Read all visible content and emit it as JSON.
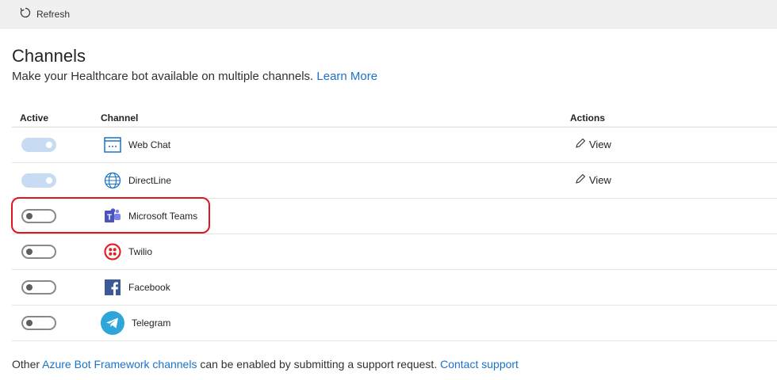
{
  "toolbar": {
    "refresh_label": "Refresh"
  },
  "page": {
    "title": "Channels",
    "subtitle": "Make your Healthcare bot available on multiple channels.",
    "learn_more": "Learn More"
  },
  "table": {
    "headers": {
      "active": "Active",
      "channel": "Channel",
      "actions": "Actions"
    },
    "rows": [
      {
        "name": "Web Chat",
        "active": true,
        "action": "View",
        "icon": "web-chat-icon"
      },
      {
        "name": "DirectLine",
        "active": true,
        "action": "View",
        "icon": "globe-icon"
      },
      {
        "name": "Microsoft Teams",
        "active": false,
        "action": "",
        "icon": "teams-icon"
      },
      {
        "name": "Twilio",
        "active": false,
        "action": "",
        "icon": "twilio-icon"
      },
      {
        "name": "Facebook",
        "active": false,
        "action": "",
        "icon": "facebook-icon"
      },
      {
        "name": "Telegram",
        "active": false,
        "action": "",
        "icon": "telegram-icon"
      }
    ]
  },
  "footer": {
    "prefix": "Other",
    "link1": "Azure Bot Framework channels",
    "middle": "can be enabled by submitting a support request.",
    "link2": "Contact support"
  },
  "colors": {
    "link": "#1a73c8",
    "highlight": "#e0141e",
    "toggle_on": "#c7dcf2"
  }
}
